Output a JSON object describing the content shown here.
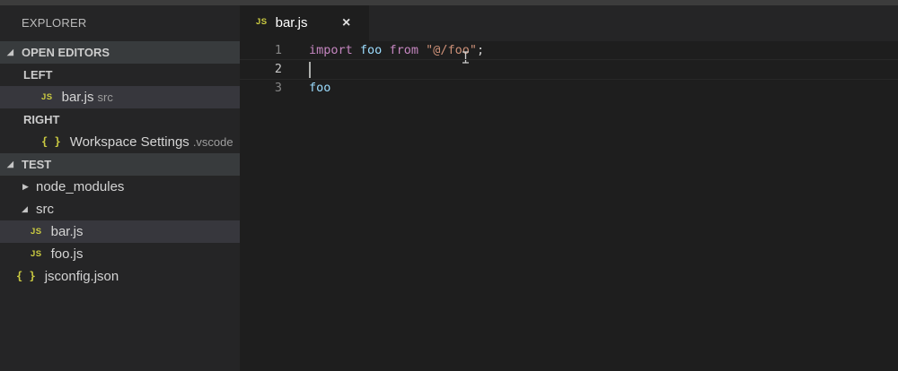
{
  "explorer": {
    "title": "EXPLORER",
    "open_editors": {
      "label": "OPEN EDITORS",
      "groups": [
        {
          "label": "LEFT",
          "files": [
            {
              "icon": "js",
              "name": "bar.js",
              "description": "src"
            }
          ]
        },
        {
          "label": "RIGHT",
          "files": [
            {
              "icon": "json",
              "name": "Workspace Settings",
              "description": ".vscode"
            }
          ]
        }
      ]
    },
    "project": {
      "label": "TEST",
      "tree": [
        {
          "name": "node_modules",
          "type": "folder",
          "expanded": false
        },
        {
          "name": "src",
          "type": "folder",
          "expanded": true
        },
        {
          "name": "bar.js",
          "type": "js"
        },
        {
          "name": "foo.js",
          "type": "js"
        },
        {
          "name": "jsconfig.json",
          "type": "json"
        }
      ]
    },
    "icon_labels": {
      "js": "JS",
      "json": "{ }"
    }
  },
  "tabs": [
    {
      "icon": "js",
      "label": "bar.js",
      "close": "×"
    }
  ],
  "editor": {
    "lines": [
      {
        "number": "1",
        "tokens": [
          {
            "t": "import",
            "c": "kw"
          },
          {
            "t": " ",
            "c": "punc"
          },
          {
            "t": "foo",
            "c": "id"
          },
          {
            "t": " ",
            "c": "punc"
          },
          {
            "t": "from",
            "c": "kw"
          },
          {
            "t": " ",
            "c": "punc"
          },
          {
            "t": "\"@/foo\"",
            "c": "str"
          },
          {
            "t": ";",
            "c": "punc"
          }
        ]
      },
      {
        "number": "2",
        "tokens": []
      },
      {
        "number": "3",
        "tokens": [
          {
            "t": "foo",
            "c": "id"
          }
        ]
      }
    ],
    "cursor_line": "2"
  },
  "colors": {
    "accent_badge": "#cbcb41",
    "keyword": "#c586c0",
    "identifier": "#9cdcfe",
    "string": "#ce9178"
  }
}
